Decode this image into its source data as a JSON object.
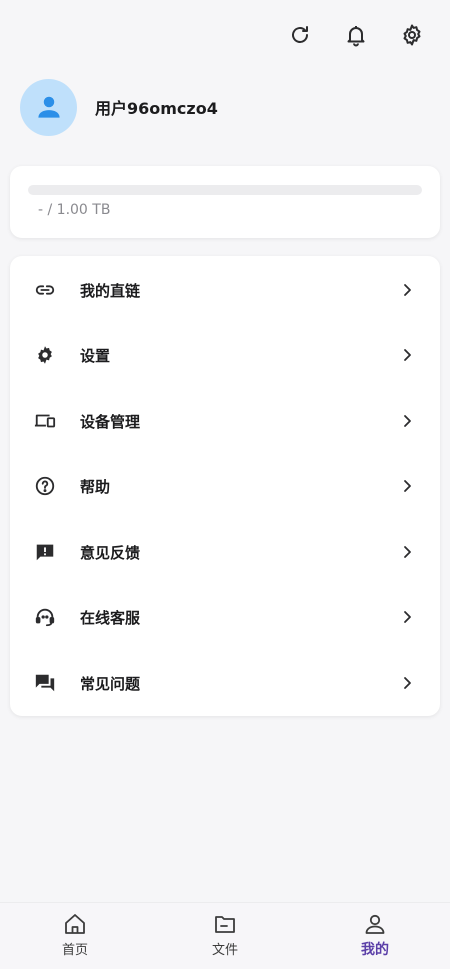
{
  "topbar": {
    "icons": [
      "refresh-icon",
      "bell-icon",
      "gear-icon"
    ]
  },
  "profile": {
    "username": "用户96omczo4",
    "avatar_icon": "user-icon",
    "avatar_color": "#bfe0fb",
    "avatar_icon_color": "#2b8fe8"
  },
  "storage": {
    "used_fraction": 0,
    "text": "- / 1.00 TB"
  },
  "menu": {
    "items": [
      {
        "label": "我的直链",
        "icon": "link-icon"
      },
      {
        "label": "设置",
        "icon": "gear-icon"
      },
      {
        "label": "设备管理",
        "icon": "devices-icon"
      },
      {
        "label": "帮助",
        "icon": "help-icon"
      },
      {
        "label": "意见反馈",
        "icon": "feedback-icon"
      },
      {
        "label": "在线客服",
        "icon": "support-agent-icon"
      },
      {
        "label": "常见问题",
        "icon": "forum-icon"
      }
    ]
  },
  "bottom_nav": {
    "items": [
      {
        "label": "首页",
        "icon": "home-icon",
        "active": false
      },
      {
        "label": "文件",
        "icon": "folder-icon",
        "active": false
      },
      {
        "label": "我的",
        "icon": "person-icon",
        "active": true
      }
    ],
    "active_color": "#5b3fa8"
  }
}
